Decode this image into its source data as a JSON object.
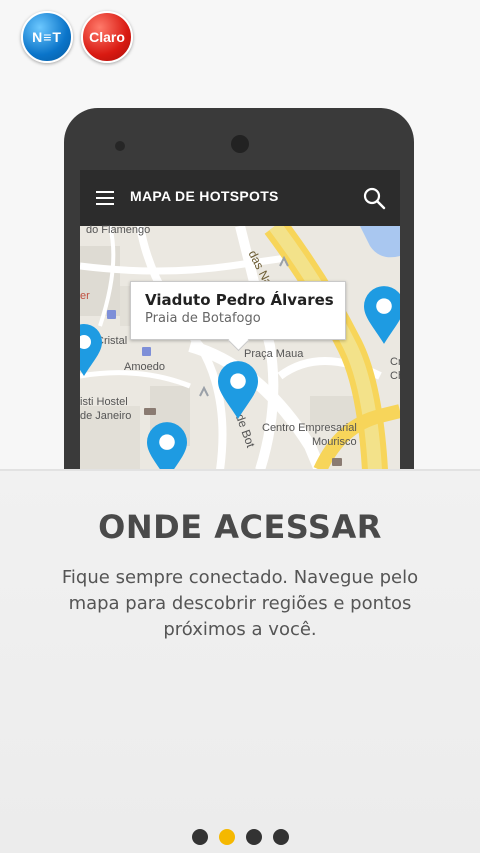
{
  "logos": {
    "net": "N≡T",
    "claro": "Claro"
  },
  "app_bar": {
    "title": "MAPA DE HOTSPOTS",
    "menu_icon": "menu-icon",
    "search_icon": "search-icon"
  },
  "map": {
    "labels": {
      "flamengo": "do Flamengo",
      "cristal": "Cristal",
      "amoedo": "Amoedo",
      "hostel_1": "isti Hostel",
      "hostel_2": "de Janeiro",
      "praca_maua": "Praça Maua",
      "centro_1": "Centro Empresarial",
      "centro_2": "Mourisco",
      "nacoes": "das Naçõ",
      "botafogo_street": "de Bot",
      "right_1": "Cr",
      "right_2": "Ch",
      "left_e": "er"
    },
    "popup": {
      "title": "Viaduto Pedro Álvares",
      "subtitle": "Praia de Botafogo"
    },
    "pin_color": "#1e9be2"
  },
  "onboarding": {
    "heading": "ONDE ACESSAR",
    "description": "Fique sempre conectado. Navegue pelo mapa para descobrir regiões e pontos próximos a você.",
    "page_count": 4,
    "active_page": 2,
    "active_color": "#f5b800"
  }
}
